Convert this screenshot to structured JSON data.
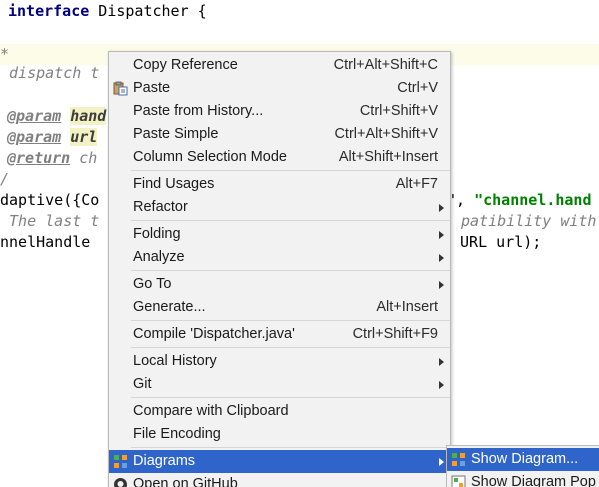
{
  "editor": {
    "lines": {
      "l1_kw": "interface",
      "l1_rest": " Dispatcher {",
      "l2": "*",
      "l3": " dispatch t",
      "l4_tag": "@param",
      "l4_hl": "hand",
      "l5_tag": "@param",
      "l5_hl": "url",
      "l6_tag": "@return",
      "l6_rest": " ch",
      "l7": "/",
      "l8_a": "daptive({Co",
      "l8_b": "\", ",
      "l8_str": "\"channel.hand",
      "l9_a": " The last t",
      "l9_b": "patibility with",
      "l10_a": "nnelHandle",
      "l10_b": " URL url);"
    }
  },
  "context_menu": {
    "items": {
      "copy_reference": {
        "label": "Copy Reference",
        "shortcut": "Ctrl+Alt+Shift+C"
      },
      "paste": {
        "label": "Paste",
        "shortcut": "Ctrl+V",
        "icon": "paste-icon"
      },
      "paste_from_history": {
        "label": "Paste from History...",
        "shortcut": "Ctrl+Shift+V"
      },
      "paste_simple": {
        "label": "Paste Simple",
        "shortcut": "Ctrl+Alt+Shift+V"
      },
      "column_selection_mode": {
        "label": "Column Selection Mode",
        "shortcut": "Alt+Shift+Insert"
      },
      "find_usages": {
        "label": "Find Usages",
        "shortcut": "Alt+F7"
      },
      "refactor": {
        "label": "Refactor"
      },
      "folding": {
        "label": "Folding"
      },
      "analyze": {
        "label": "Analyze"
      },
      "go_to": {
        "label": "Go To"
      },
      "generate": {
        "label": "Generate...",
        "shortcut": "Alt+Insert"
      },
      "compile": {
        "label": "Compile 'Dispatcher.java'",
        "shortcut": "Ctrl+Shift+F9"
      },
      "local_history": {
        "label": "Local History"
      },
      "git": {
        "label": "Git"
      },
      "compare_clipboard": {
        "label": "Compare with Clipboard"
      },
      "file_encoding": {
        "label": "File Encoding"
      },
      "diagrams": {
        "label": "Diagrams",
        "icon": "diagram-icon"
      },
      "open_github": {
        "label": "Open on GitHub",
        "icon": "github-icon"
      }
    },
    "selected": "diagrams"
  },
  "submenu": {
    "items": {
      "show_diagram": {
        "label": "Show Diagram...",
        "icon": "diagram-icon"
      },
      "show_diagram_popup": {
        "label": "Show Diagram Pop",
        "icon": "diagram-popup-icon"
      }
    },
    "selected": "show_diagram"
  },
  "colors": {
    "selection": "#2f65ca",
    "menu_bg": "#f2f2f2",
    "keyword": "#000080",
    "string": "#008000",
    "doc_comment": "#808080"
  }
}
